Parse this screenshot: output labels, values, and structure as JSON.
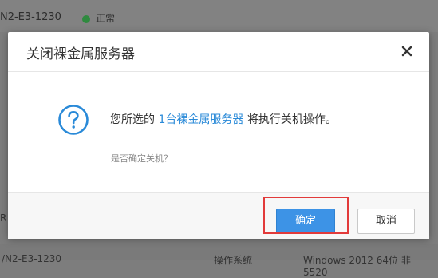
{
  "background": {
    "model_top": "N2-E3-1230",
    "status": "正常",
    "left_fragment": "R",
    "model_bottom": "/N2-E3-1230",
    "os_label": "操作系统",
    "os_value": "Windows 2012 64位 非 5520"
  },
  "dialog": {
    "title": "关闭裸金属服务器",
    "message_prefix": "您所选的",
    "message_highlight": "1台裸金属服务器",
    "message_suffix": "将执行关机操作。",
    "sub_message": "是否确定关机？",
    "confirm_label": "确定",
    "cancel_label": "取消"
  },
  "colors": {
    "accent": "#3d93e6",
    "highlight_text": "#2a8ad8",
    "status_dot": "#2f8a3f",
    "annotation_box": "#e23a3a"
  },
  "icons": {
    "close": "close-icon",
    "question": "question-icon",
    "status": "status-dot-icon"
  }
}
